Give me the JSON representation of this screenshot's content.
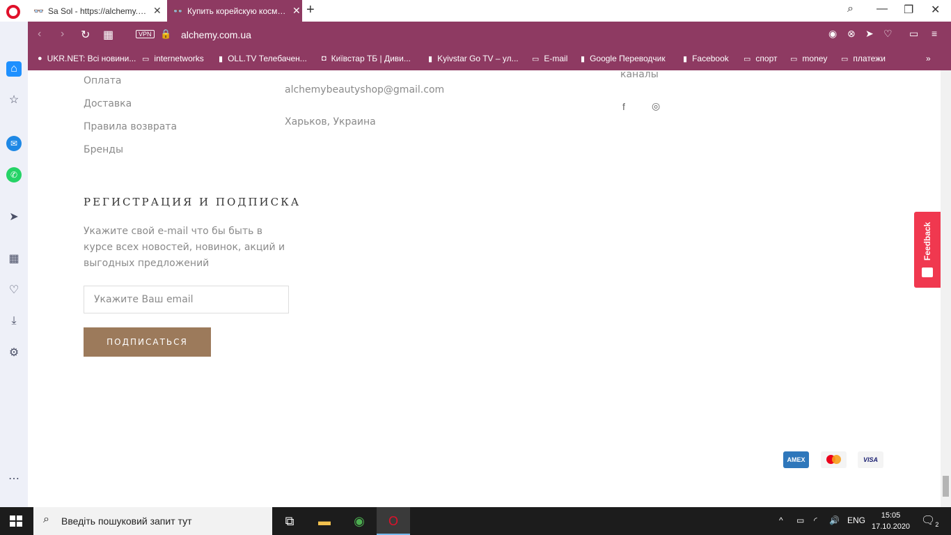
{
  "tabs": [
    {
      "label": "Sa Sol - https://alchemy.com.ua"
    },
    {
      "label": "Купить корейскую косметику"
    }
  ],
  "address": {
    "url": "alchemy.com.ua",
    "vpn": "VPN"
  },
  "bookmarks": [
    {
      "label": "UKR.NET: Всі новини...",
      "icon": "ukrnet-icon"
    },
    {
      "label": "internetworks",
      "icon": "folder-icon"
    },
    {
      "label": "OLL.TV Телебачен...",
      "icon": "page-icon"
    },
    {
      "label": "Київстар ТБ | Диви...",
      "icon": "kyivstar-icon"
    },
    {
      "label": "Kyivstar Go TV – ул...",
      "icon": "page-icon"
    },
    {
      "label": "E-mail",
      "icon": "folder-icon"
    },
    {
      "label": "Google Переводчик",
      "icon": "page-icon"
    },
    {
      "label": "Facebook",
      "icon": "page-icon"
    },
    {
      "label": "спорт",
      "icon": "folder-icon"
    },
    {
      "label": "money",
      "icon": "folder-icon"
    },
    {
      "label": "платежи",
      "icon": "folder-icon"
    }
  ],
  "footer": {
    "links": [
      "Оплата",
      "Доставка",
      "Правила возврата",
      "Бренды"
    ],
    "contact_email": "alchemybeautyshop@gmail.com",
    "city": "Харьков, Украина",
    "channels_label": "каналы",
    "subscribe_heading": "РЕГИСТРАЦИЯ И ПОДПИСКА",
    "subscribe_desc": "Укажите свой e-mail что бы быть в курсе всех новостей, новинок, акций и выгодных предложений",
    "email_placeholder": "Укажите Ваш email",
    "subscribe_button": "ПОДПИСАТЬСЯ",
    "payments": [
      "AMEX",
      "VISA"
    ]
  },
  "feedback": "Feedback",
  "taskbar": {
    "search_placeholder": "Введіть пошуковий запит тут",
    "language": "ENG",
    "time": "15:05",
    "date": "17.10.2020",
    "notifications": "2"
  }
}
